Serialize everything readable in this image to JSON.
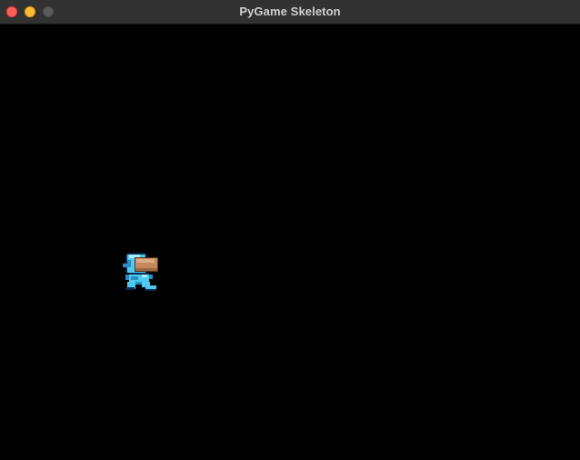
{
  "window": {
    "title": "PyGame Skeleton",
    "controls": {
      "close_color": "#ff5f57",
      "minimize_color": "#febc2e",
      "zoom_color": "#5a5a5a"
    }
  },
  "game": {
    "background_color": "#000000",
    "player": {
      "icon": "astronaut-player-sprite",
      "suit_color": "#4fc8ef",
      "visor_color": "#c48a5e"
    }
  }
}
